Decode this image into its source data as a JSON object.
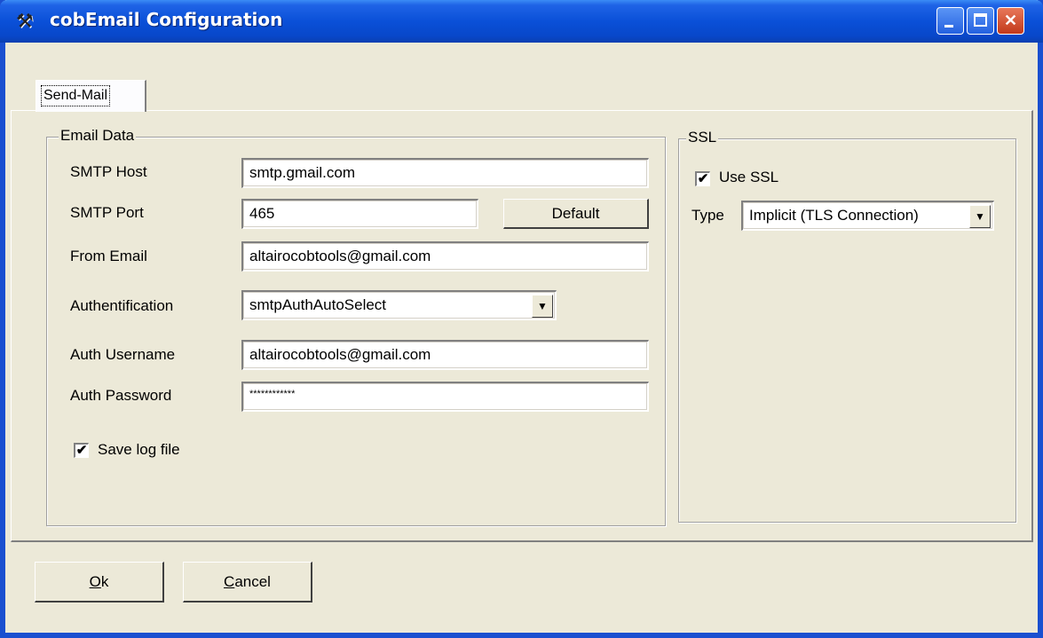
{
  "window": {
    "title": "cobEmail Configuration",
    "app_icon": "tools-icon"
  },
  "tabs": [
    {
      "label": "Send-Mail",
      "selected": true
    }
  ],
  "email_group": {
    "legend": "Email Data",
    "smtp_host": {
      "label": "SMTP Host",
      "value": "smtp.gmail.com"
    },
    "smtp_port": {
      "label": "SMTP Port",
      "value": "465",
      "default_button": "Default"
    },
    "from_email": {
      "label": "From Email",
      "value": "altairocobtools@gmail.com"
    },
    "authentification": {
      "label": "Authentification",
      "value": "smtpAuthAutoSelect"
    },
    "auth_username": {
      "label": "Auth Username",
      "value": "altairocobtools@gmail.com"
    },
    "auth_password": {
      "label": "Auth Password",
      "value": "************"
    },
    "save_log": {
      "label": "Save log file",
      "checked": true
    }
  },
  "ssl_group": {
    "legend": "SSL",
    "use_ssl": {
      "label": "Use SSL",
      "checked": true
    },
    "type": {
      "label": "Type",
      "value": "Implicit (TLS Connection)"
    }
  },
  "buttons": {
    "ok_accel": "O",
    "ok_rest": "k",
    "cancel_accel": "C",
    "cancel_rest": "ancel"
  },
  "colors": {
    "titlebar": "#0a50d8",
    "face": "#ece9d8"
  }
}
